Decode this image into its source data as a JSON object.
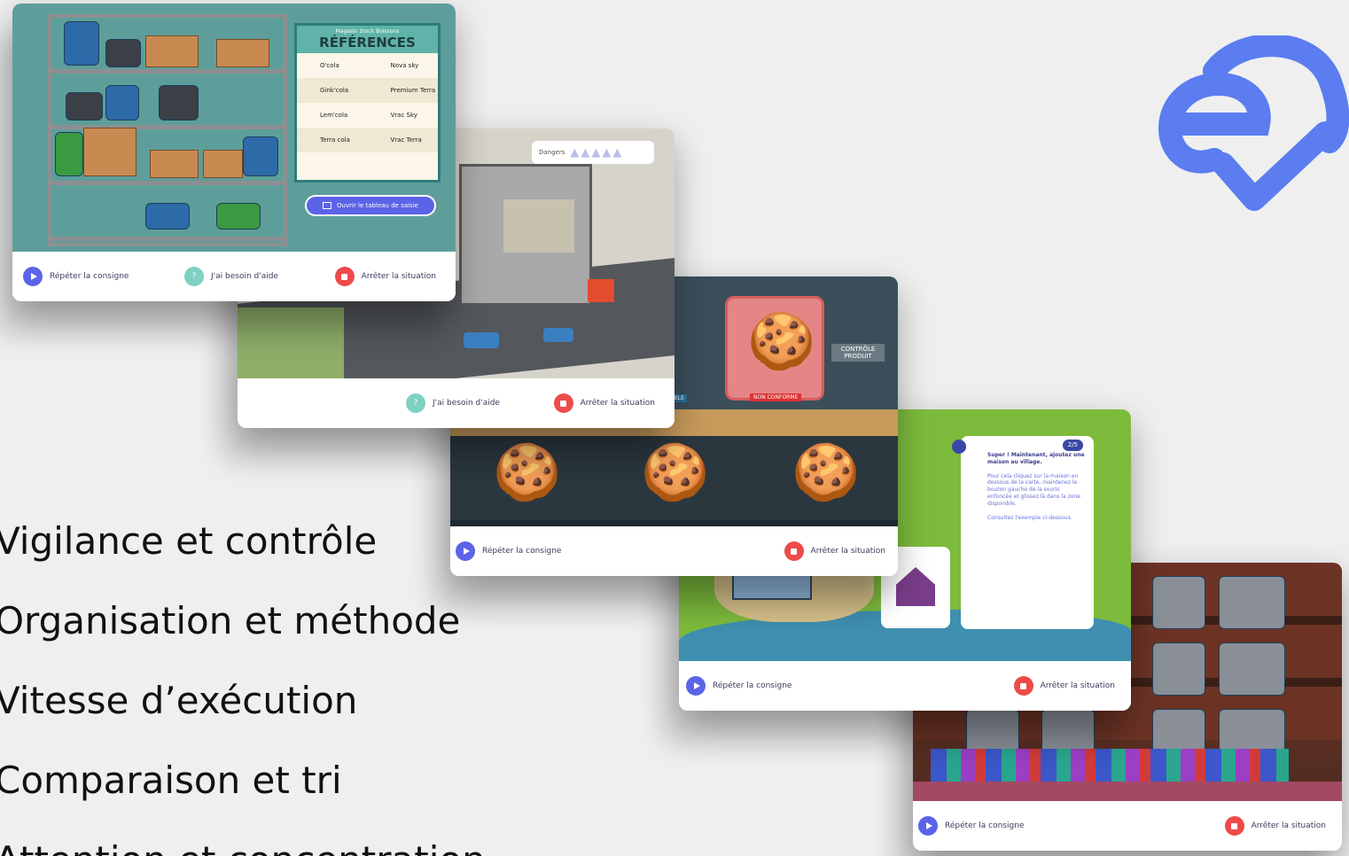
{
  "skills": [
    "Vigilance et contrôle",
    "Organisation et méthode",
    "Vitesse d’exécution",
    "Comparaison et tri",
    "Attention et concentration"
  ],
  "common": {
    "repeat": "Répéter la consigne",
    "help": "J'ai besoin d'aide",
    "stop": "Arrêter la situation",
    "help_icon": "?"
  },
  "warehouse": {
    "store": "Magasin Stock Boissons",
    "title": "RÉFÉRENCES",
    "items": [
      [
        "O'cola",
        "Nova sky"
      ],
      [
        "Gink'cola",
        "Premium Terra"
      ],
      [
        "Lem'cola",
        "Vrac Sky"
      ],
      [
        "Terra cola",
        "Vrac Terra"
      ]
    ],
    "button": "Ouvrir le tableau de saisie"
  },
  "construction": {
    "dangers": "Dangers"
  },
  "factory": {
    "control": "CONTRÔLE PRODUIT",
    "badge": "NON CONFORME",
    "tag": "ELE"
  },
  "village": {
    "step": "2/5",
    "title": "Super ! Maintenant, ajoutez une maison au village.",
    "body": "Pour cela cliquez sur la maison en dessous de la carte, maintenez le bouton gauche de la souris enfoncée et glissez là dans la zone disponible.",
    "example": "Consultez l'exemple ci-dessous."
  },
  "colors": {
    "accent": "#5b63e8",
    "stop": "#ee4a4a",
    "help": "#7fd1c2",
    "logo": "#5b7df0"
  }
}
